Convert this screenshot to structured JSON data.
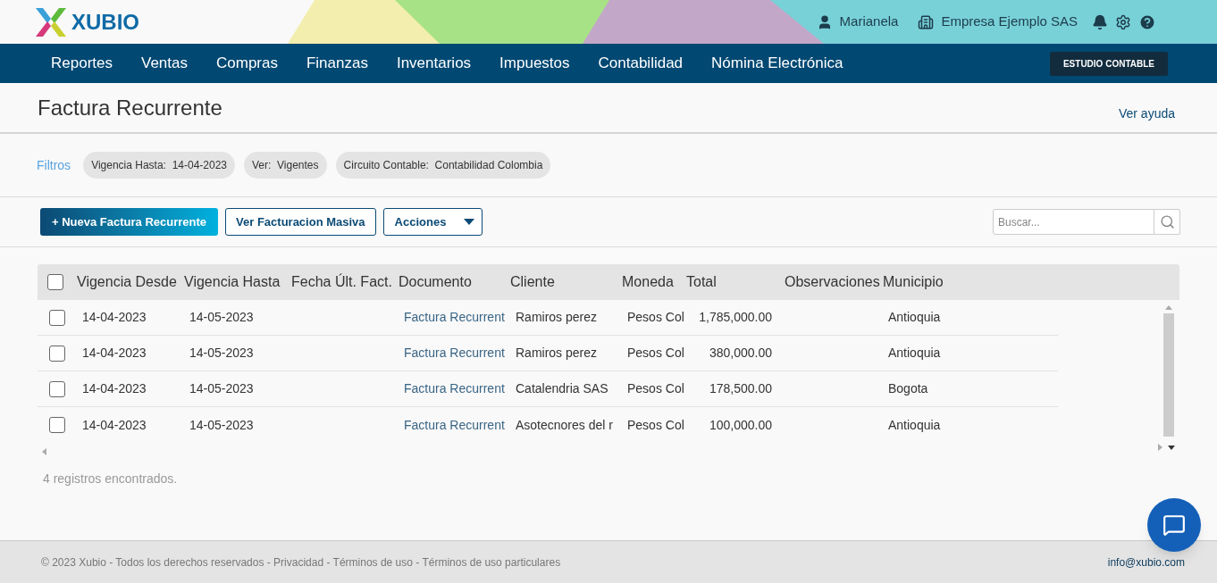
{
  "header": {
    "logo": "XUBIO",
    "user": "Marianela",
    "company": "Empresa Ejemplo SAS"
  },
  "nav": {
    "items": [
      "Reportes",
      "Ventas",
      "Compras",
      "Finanzas",
      "Inventarios",
      "Impuestos",
      "Contabilidad",
      "Nómina Electrónica"
    ],
    "badge": "ESTUDIO CONTABLE"
  },
  "page": {
    "title": "Factura Recurrente",
    "help": "Ver ayuda"
  },
  "filters": {
    "label": "Filtros",
    "chips": [
      {
        "name": "Vigencia Hasta:",
        "value": "14-04-2023"
      },
      {
        "name": "Ver:",
        "value": "Vigentes"
      },
      {
        "name": "Circuito Contable:",
        "value": "Contabilidad Colombia"
      }
    ]
  },
  "toolbar": {
    "primary": "+ Nueva Factura Recurrente",
    "secondary": "Ver Facturacion Masiva",
    "actions": "Acciones",
    "search": {
      "placeholder": "Buscar..."
    }
  },
  "table": {
    "all_checked": false,
    "columns": [
      "Vigencia Desde",
      "Vigencia Hasta",
      "Fecha Últ. Fact.",
      "Documento",
      "Cliente",
      "Moneda",
      "Total",
      "Observaciones",
      "Municipio"
    ],
    "rows": [
      {
        "checked": false,
        "cells": [
          "14-04-2023",
          "14-05-2023",
          "",
          "Factura Recurrent",
          "Ramiros perez",
          "Pesos Col",
          "1,785,000.00",
          "",
          "Antioquia"
        ]
      },
      {
        "checked": false,
        "cells": [
          "14-04-2023",
          "14-05-2023",
          "",
          "Factura Recurrent",
          "Ramiros perez",
          "Pesos Col",
          "380,000.00",
          "",
          "Antioquia"
        ]
      },
      {
        "checked": false,
        "cells": [
          "14-04-2023",
          "14-05-2023",
          "",
          "Factura Recurrent",
          "Catalendria SAS",
          "Pesos Col",
          "178,500.00",
          "",
          "Bogota"
        ]
      },
      {
        "checked": false,
        "cells": [
          "14-04-2023",
          "14-05-2023",
          "",
          "Factura Recurrent",
          "Asotecnores del r",
          "Pesos Col",
          "100,000.00",
          "",
          "Antioquia"
        ]
      }
    ],
    "count": "4 registros encontrados."
  },
  "footer": {
    "text": "© 2023 Xubio - Todos los derechos reservados - Privacidad - Términos de uso - Términos de uso particulares",
    "email": "info@xubio.com"
  }
}
